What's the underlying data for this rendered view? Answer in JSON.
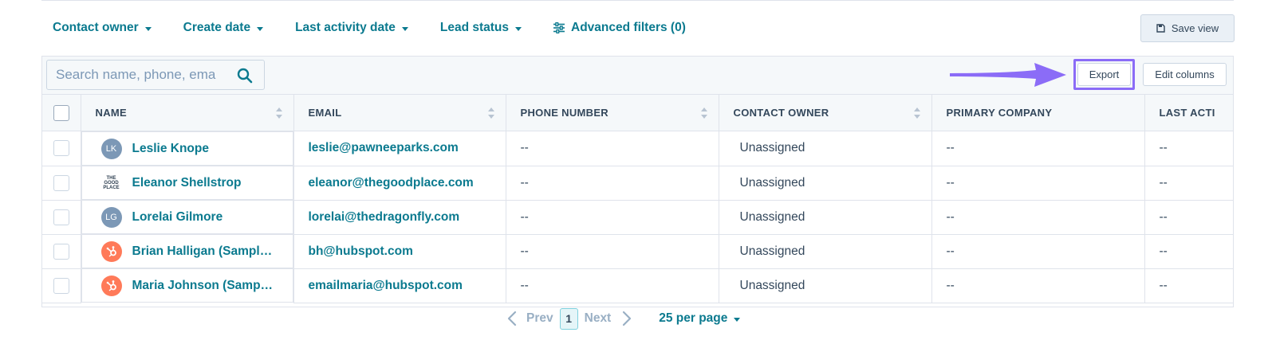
{
  "filters": [
    {
      "label": "Contact owner"
    },
    {
      "label": "Create date"
    },
    {
      "label": "Last activity date"
    },
    {
      "label": "Lead status"
    }
  ],
  "advanced_filters": {
    "label": "Advanced filters (0)"
  },
  "save_view": {
    "label": "Save view"
  },
  "search": {
    "placeholder": "Search name, phone, ema"
  },
  "actions": {
    "export_label": "Export",
    "edit_columns_label": "Edit columns"
  },
  "columns": [
    "NAME",
    "EMAIL",
    "PHONE NUMBER",
    "CONTACT OWNER",
    "PRIMARY COMPANY",
    "LAST ACTI"
  ],
  "rows": [
    {
      "avatar": "LK",
      "avatar_type": "initials",
      "name": "Leslie Knope",
      "email": "leslie@pawneeparks.com",
      "phone": "--",
      "owner": "Unassigned",
      "company": "--",
      "last_activity": "--"
    },
    {
      "avatar": "THE GOOD PLACE",
      "avatar_type": "logo",
      "name": "Eleanor Shellstrop",
      "email": "eleanor@thegoodplace.com",
      "phone": "--",
      "owner": "Unassigned",
      "company": "--",
      "last_activity": "--"
    },
    {
      "avatar": "LG",
      "avatar_type": "initials",
      "name": "Lorelai Gilmore",
      "email": "lorelai@thedragonfly.com",
      "phone": "--",
      "owner": "Unassigned",
      "company": "--",
      "last_activity": "--"
    },
    {
      "avatar": "hubspot-icon",
      "avatar_type": "hub",
      "name": "Brian Halligan (Sampl…",
      "email": "bh@hubspot.com",
      "phone": "--",
      "owner": "Unassigned",
      "company": "--",
      "last_activity": "--"
    },
    {
      "avatar": "hubspot-icon",
      "avatar_type": "hub",
      "name": "Maria Johnson (Samp…",
      "email": "emailmaria@hubspot.com",
      "phone": "--",
      "owner": "Unassigned",
      "company": "--",
      "last_activity": "--"
    }
  ],
  "pagination": {
    "prev_label": "Prev",
    "current_page": "1",
    "next_label": "Next",
    "per_page_label": "25 per page"
  },
  "colors": {
    "link": "#0b7a8f",
    "highlight": "#8b6cf7",
    "hub_avatar": "#ff7a59",
    "initials_avatar": "#7c98b6"
  }
}
